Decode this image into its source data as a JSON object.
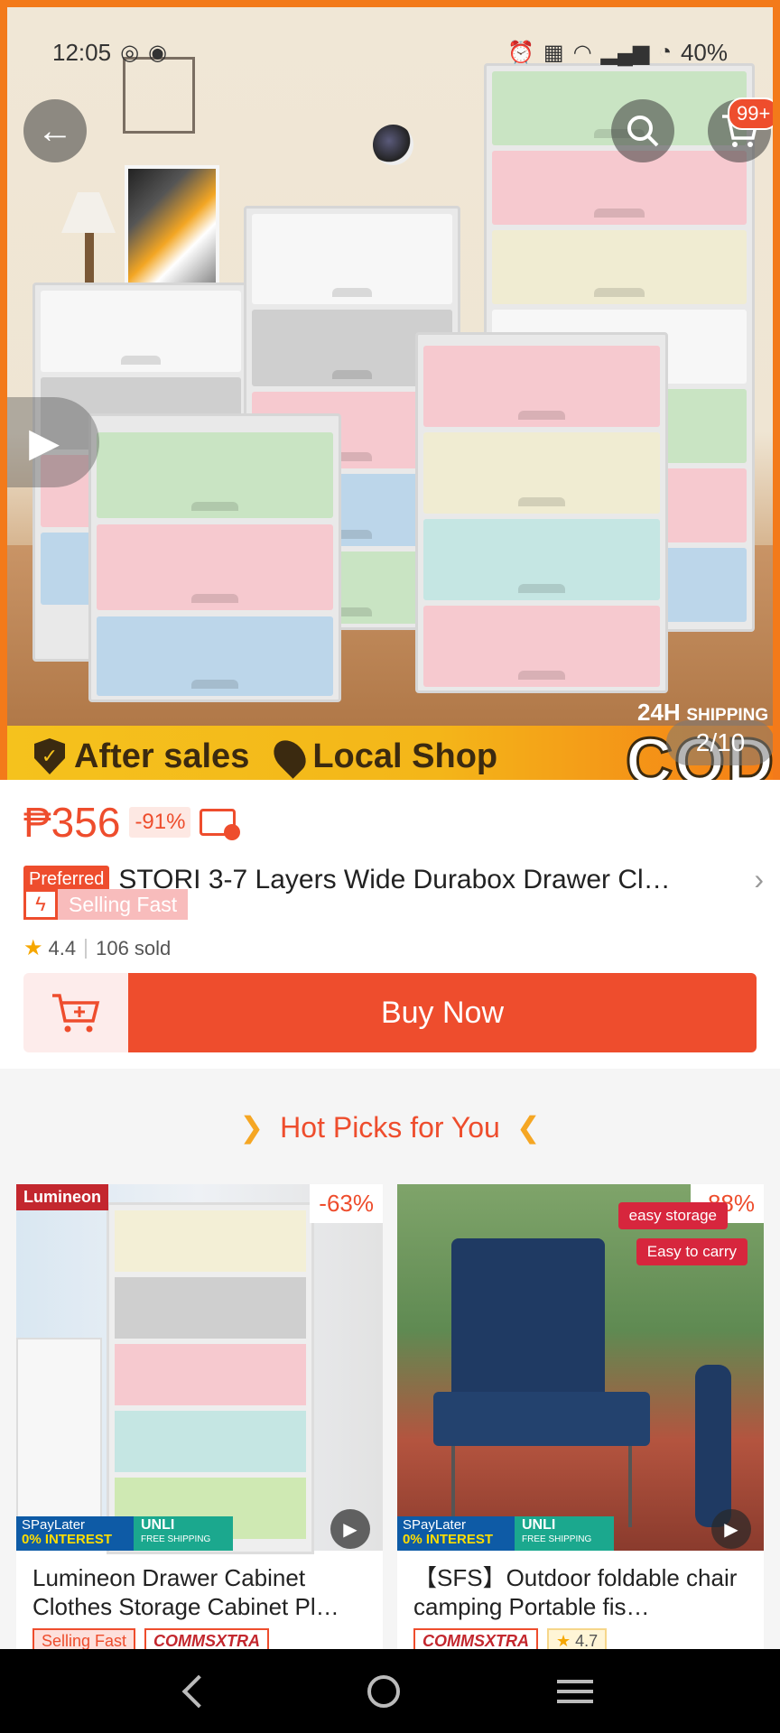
{
  "status_bar": {
    "time": "12:05",
    "battery": "40%"
  },
  "header": {
    "cart_badge": "99+"
  },
  "hero": {
    "image_counter": "2/10",
    "badges": [
      "After sales",
      "Local Shop"
    ],
    "shipping_label": "24H",
    "shipping_sub": "SHIPPING",
    "cod_label": "COD"
  },
  "product": {
    "price": "₱356",
    "discount": "-91%",
    "preferred_label": "Preferred",
    "title": "STORI 3-7 Layers Wide Durabox Drawer Cl…",
    "selling_fast": "Selling Fast",
    "rating": "4.4",
    "sold": "106 sold",
    "buy_now": "Buy Now"
  },
  "hot_picks": {
    "heading": "Hot Picks for You",
    "items": [
      {
        "brand": "Lumineon",
        "discount": "-63%",
        "promo_spay": "SPayLater",
        "promo_interest": "0% INTEREST",
        "promo_unli": "UNLI",
        "promo_ship": "FREE SHIPPING",
        "title": "Lumineon Drawer Cabinet Clothes Storage Cabinet Pl…",
        "tag1": "Selling Fast",
        "tag2": "COMMSXTRA"
      },
      {
        "discount": "-88%",
        "promo_spay": "SPayLater",
        "promo_interest": "0% INTEREST",
        "promo_unli": "UNLI",
        "promo_ship": "FREE SHIPPING",
        "easy_storage": "easy storage",
        "easy_carry": "Easy to carry",
        "title": "【SFS】Outdoor foldable chair camping Portable fis…",
        "tag1": "COMMSXTRA",
        "tag2": "4.7"
      }
    ]
  },
  "colors": {
    "accent": "#ee4d2d",
    "banner_yellow": "#f5c21d"
  }
}
